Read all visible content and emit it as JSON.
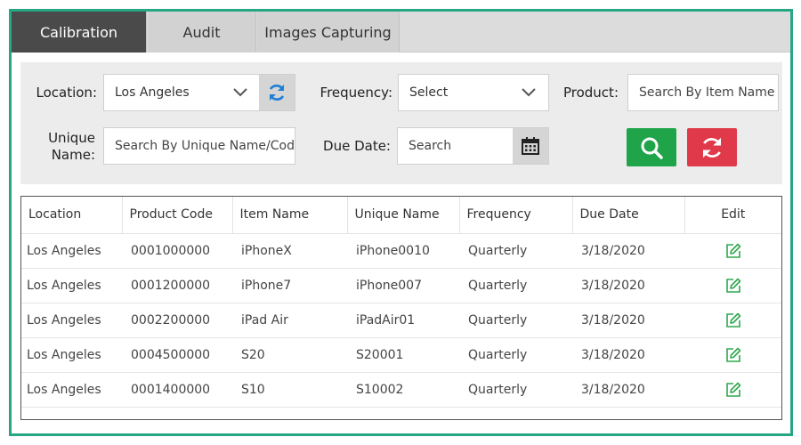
{
  "tabs": [
    {
      "label": "Calibration",
      "active": true
    },
    {
      "label": "Audit",
      "active": false
    },
    {
      "label": "Images Capturing",
      "active": false
    }
  ],
  "filters": {
    "location_label": "Location:",
    "location_value": "Los Angeles",
    "frequency_label": "Frequency:",
    "frequency_value": "Select",
    "product_label": "Product:",
    "product_placeholder": "Search By Item Name",
    "unique_name_label_line1": "Unique",
    "unique_name_label_line2": "Name:",
    "unique_name_placeholder": "Search By Unique Name/Code",
    "due_date_label": "Due Date:",
    "due_date_placeholder": "Search"
  },
  "table": {
    "headers": [
      "Location",
      "Product Code",
      "Item Name",
      "Unique Name",
      "Frequency",
      "Due Date",
      "Edit"
    ],
    "rows": [
      [
        "Los Angeles",
        "0001000000",
        "iPhoneX",
        "iPhone0010",
        "Quarterly",
        "3/18/2020"
      ],
      [
        "Los Angeles",
        "0001200000",
        "iPhone7",
        "iPhone007",
        "Quarterly",
        "3/18/2020"
      ],
      [
        "Los Angeles",
        "0002200000",
        "iPad Air",
        "iPadAir01",
        "Quarterly",
        "3/18/2020"
      ],
      [
        "Los Angeles",
        "0004500000",
        "S20",
        "S20001",
        "Quarterly",
        "3/18/2020"
      ],
      [
        "Los Angeles",
        "0001400000",
        "S10",
        "S10002",
        "Quarterly",
        "3/18/2020"
      ]
    ]
  },
  "colors": {
    "frame_border": "#27a684",
    "active_tab": "#4a4a4a",
    "search_button": "#20a44a",
    "reset_button": "#e03a4a",
    "refresh_icon": "#1e7fd6",
    "edit_icon": "#2fa84f"
  },
  "icons": {
    "location_refresh": "refresh-icon",
    "dropdown": "chevron-down-icon",
    "due_date": "calendar-icon",
    "search_button": "search-icon",
    "reset_button": "reset-icon",
    "row_edit": "edit-icon"
  }
}
